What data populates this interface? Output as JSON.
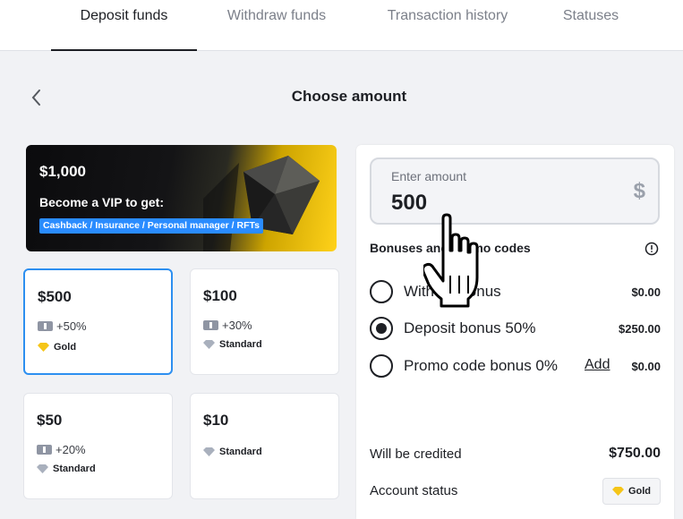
{
  "tabs": [
    {
      "label": "Deposit funds",
      "active": true
    },
    {
      "label": "Withdraw funds",
      "active": false
    },
    {
      "label": "Transaction history",
      "active": false
    },
    {
      "label": "Statuses",
      "active": false
    }
  ],
  "header": {
    "title": "Choose amount",
    "back_icon": "chevron-left-icon"
  },
  "vip_banner": {
    "amount": "$1,000",
    "subtitle": "Become a VIP to get:",
    "perks": "Cashback / Insurance / Personal manager / RFTs"
  },
  "amount_cards": [
    {
      "amount": "$500",
      "bonus": "+50%",
      "status": "Gold",
      "selected": true
    },
    {
      "amount": "$100",
      "bonus": "+30%",
      "status": "Standard",
      "selected": false
    },
    {
      "amount": "$50",
      "bonus": "+20%",
      "status": "Standard",
      "selected": false
    },
    {
      "amount": "$10",
      "bonus": "",
      "status": "Standard",
      "selected": false
    }
  ],
  "amount_input": {
    "label": "Enter amount",
    "value": "500",
    "currency": "$"
  },
  "bonuses": {
    "heading": "Bonuses and promo codes",
    "options": [
      {
        "label": "Without bonus",
        "value": "$0.00",
        "selected": false
      },
      {
        "label": "Deposit bonus 50%",
        "value": "$250.00",
        "selected": true
      },
      {
        "label": "Promo code bonus 0%",
        "link": "Add",
        "value": "$0.00",
        "selected": false
      }
    ]
  },
  "summary": {
    "credited_label": "Will be credited",
    "credited_value": "$750.00",
    "account_status_label": "Account status",
    "account_status_value": "Gold"
  },
  "colors": {
    "accent": "#2d8ff0",
    "gold": "#f5c518",
    "standard": "#a9b0bd",
    "vip_chip": "#2a8cff"
  }
}
